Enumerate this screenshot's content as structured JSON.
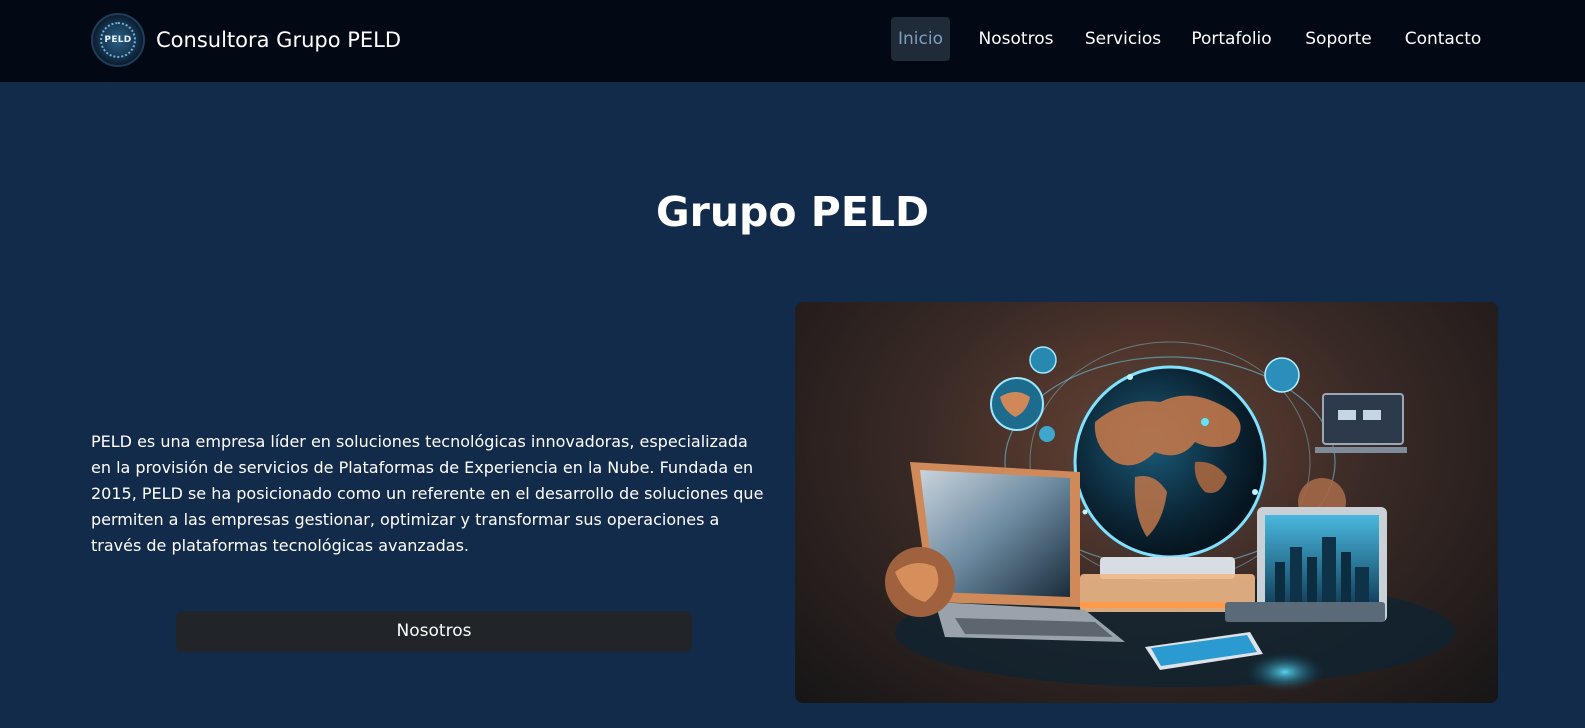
{
  "navbar": {
    "logo_text": "PELD",
    "brand_name": "Consultora Grupo PELD",
    "items": [
      {
        "label": "Inicio",
        "active": true
      },
      {
        "label": "Nosotros",
        "active": false
      },
      {
        "label": "Servicios",
        "active": false
      },
      {
        "label": "Portafolio",
        "active": false
      },
      {
        "label": "Soporte",
        "active": false
      },
      {
        "label": "Contacto",
        "active": false
      }
    ]
  },
  "hero": {
    "title": "Grupo PELD",
    "description": "PELD es una empresa líder en soluciones tecnológicas innovadoras, especializada en la provisión de servicios de Plataformas de Experiencia en la Nube. Fundada en 2015, PELD se ha posicionado como un referente en el desarrollo de soluciones que permiten a las empresas gestionar, optimizar y transformar sus operaciones a través de plataformas tecnológicas avanzadas.",
    "button_label": "Nosotros",
    "image_subject": "technology-globe-devices-illustration"
  },
  "colors": {
    "navbar_bg": "#020814",
    "page_bg": "#132b4b",
    "button_bg": "#212529",
    "active_nav_bg": "#1f2b38",
    "active_nav_text": "#7f9fbd"
  }
}
